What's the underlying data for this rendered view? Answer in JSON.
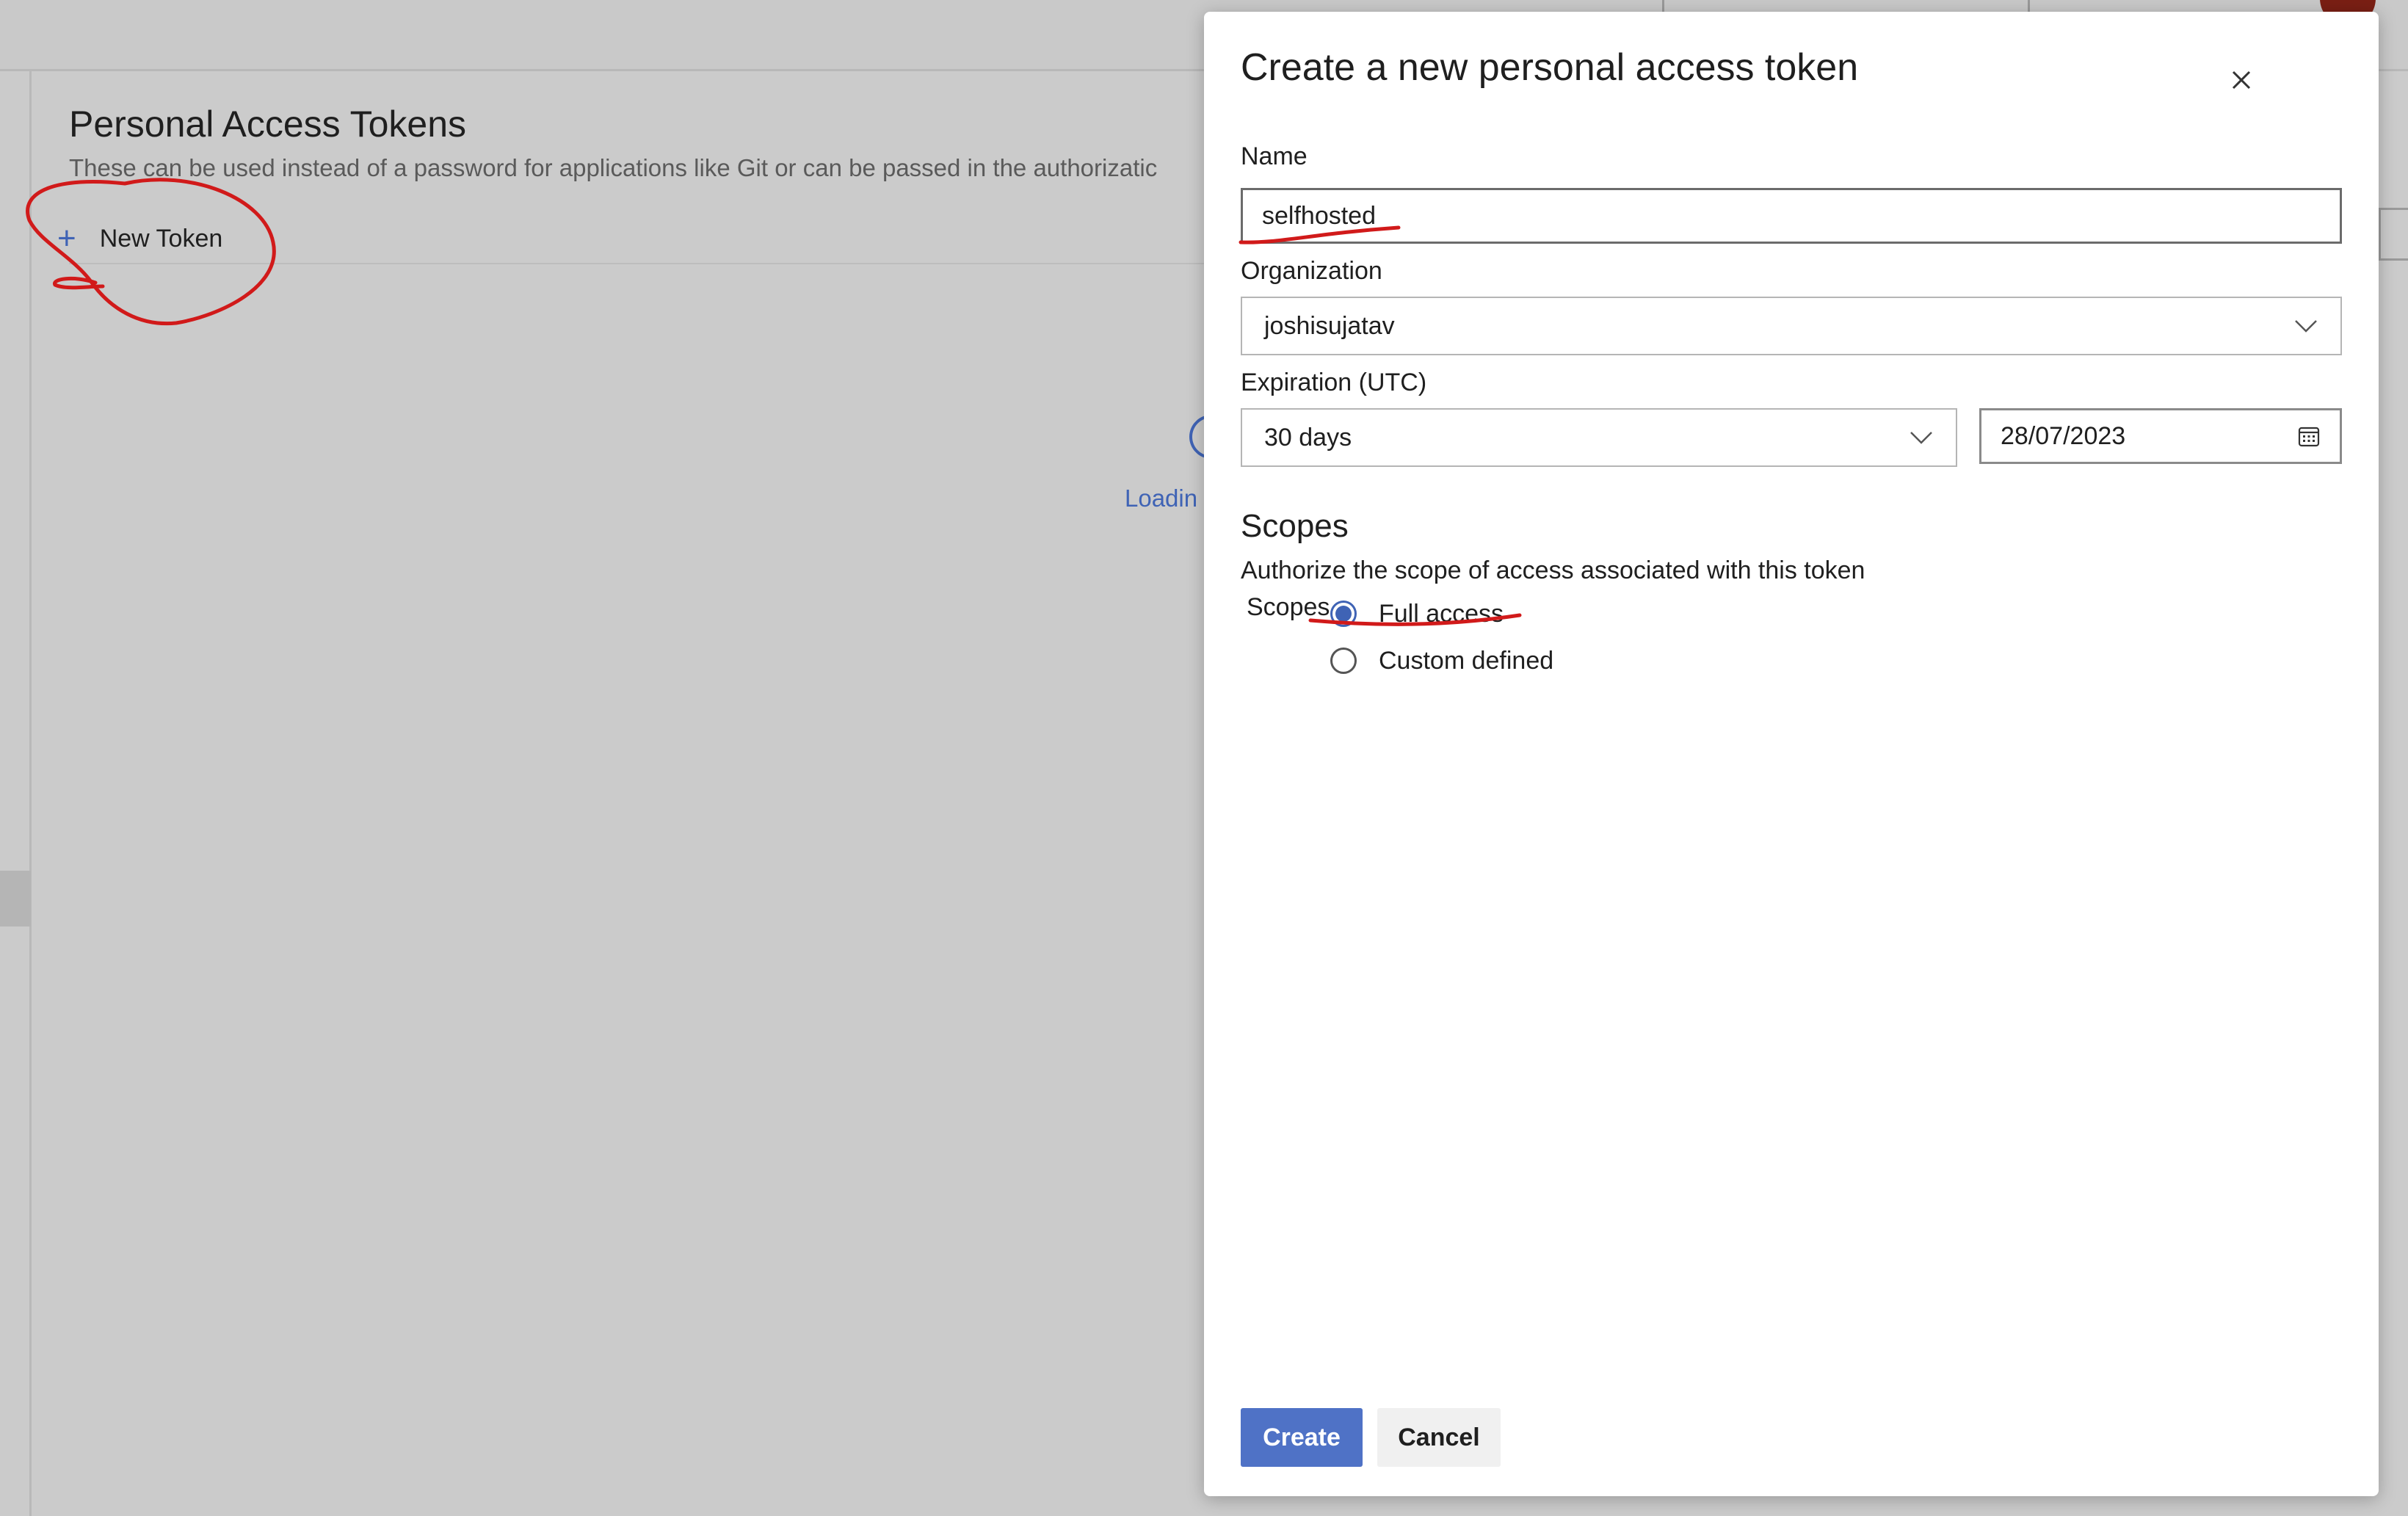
{
  "background": {
    "page_title": "Personal Access Tokens",
    "description": "These can be used instead of a password for applications like Git or can be passed in the authorizatic",
    "new_token_label": "New Token",
    "loading_text": "Loadin"
  },
  "dialog": {
    "title": "Create a new personal access token",
    "name_label": "Name",
    "name_value": "selfhosted",
    "organization_label": "Organization",
    "organization_value": "joshisujatav",
    "expiration_label": "Expiration (UTC)",
    "expiration_value": "30 days",
    "expiration_date": "28/07/2023",
    "scopes_heading": "Scopes",
    "scopes_description": "Authorize the scope of access associated with this token",
    "scopes_label": "Scopes",
    "scope_options": [
      {
        "label": "Full access",
        "selected": true
      },
      {
        "label": "Custom defined",
        "selected": false
      }
    ],
    "create_label": "Create",
    "cancel_label": "Cancel"
  },
  "colors": {
    "accent": "#3f63b5",
    "primary_button": "#4f72c6",
    "annotation": "#d11a1a",
    "overlay": "#cbcbcb"
  },
  "icons": [
    "plus-icon",
    "close-icon",
    "chevron-down-icon",
    "calendar-icon",
    "spinner-icon"
  ]
}
